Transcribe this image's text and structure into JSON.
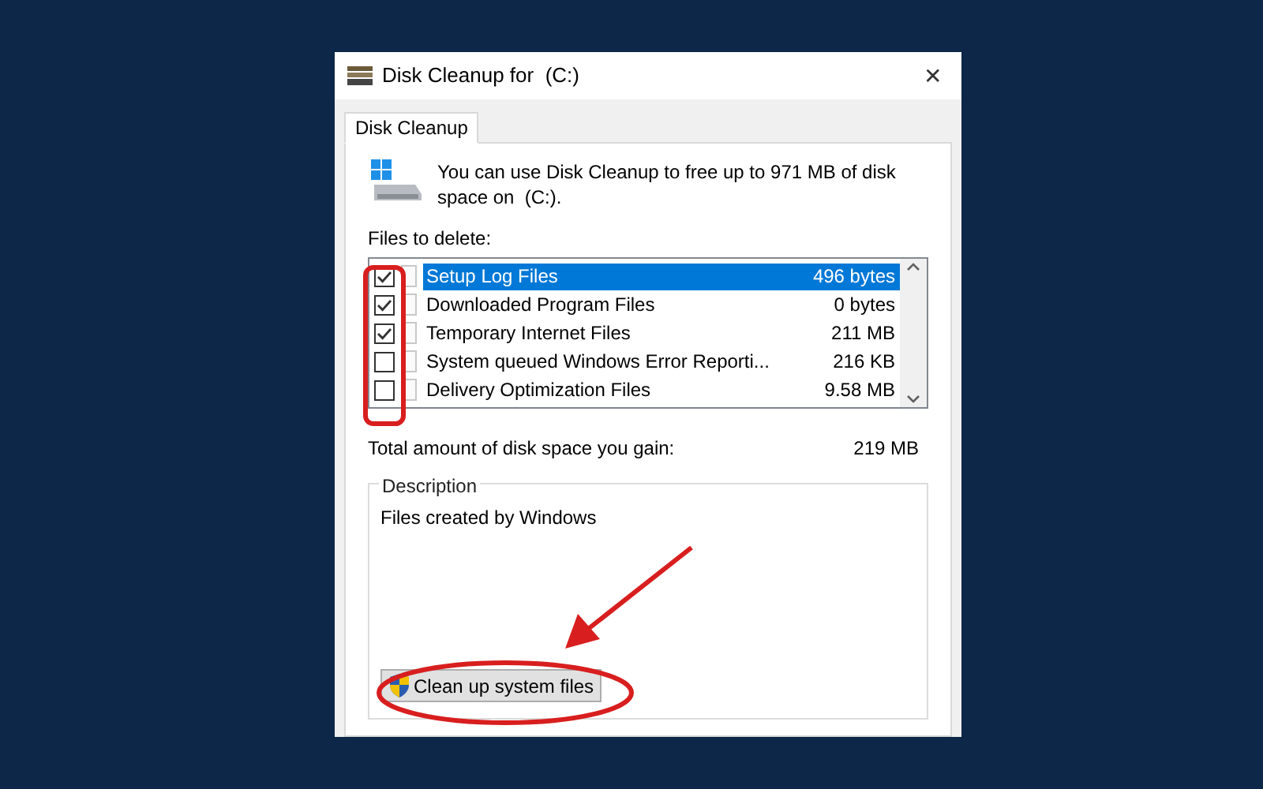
{
  "window": {
    "title": "Disk Cleanup for  (C:)",
    "close": "✕"
  },
  "tabs": [
    {
      "label": "Disk Cleanup",
      "selected": true
    }
  ],
  "intro": "You can use Disk Cleanup to free up to 971 MB of disk space on  (C:).",
  "files_label": "Files to delete:",
  "files": [
    {
      "name": "Setup Log Files",
      "size": "496 bytes",
      "checked": true,
      "selected": true
    },
    {
      "name": "Downloaded Program Files",
      "size": "0 bytes",
      "checked": true,
      "selected": false
    },
    {
      "name": "Temporary Internet Files",
      "size": "211 MB",
      "checked": true,
      "selected": false
    },
    {
      "name": "System queued Windows Error Reporti...",
      "size": "216 KB",
      "checked": false,
      "selected": false
    },
    {
      "name": "Delivery Optimization Files",
      "size": "9.58 MB",
      "checked": false,
      "selected": false
    }
  ],
  "total": {
    "label": "Total amount of disk space you gain:",
    "value": "219 MB"
  },
  "description": {
    "title": "Description",
    "text": "Files created by Windows"
  },
  "button": "Clean up system files"
}
